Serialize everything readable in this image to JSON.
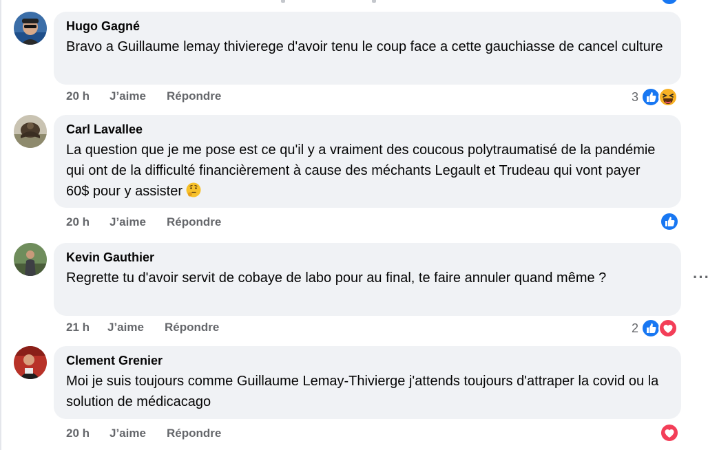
{
  "comments": [
    {
      "author": "Hugo Gagné",
      "text": "Bravo a Guillaume lemay thivierege d'avoir tenu le coup face a cette gauchiasse de cancel culture",
      "time": "20 h",
      "like_label": "J’aime",
      "reply_label": "Répondre",
      "reaction_count": "3",
      "reactions": [
        "like-icon",
        "laughing-emoji-icon"
      ]
    },
    {
      "author": "Carl Lavallee",
      "text": "La question que je me pose est ce qu'il y a vraiment des coucous polytraumatisé de la pandémie qui ont de la difficulté financièrement à cause des méchants Legault et Trudeau qui vont payer 60$ pour y assister",
      "inline_emoji": "thinking-face-emoji",
      "time": "20 h",
      "like_label": "J’aime",
      "reply_label": "Répondre",
      "reaction_count": "",
      "reactions": [
        "like-icon"
      ]
    },
    {
      "author": "Kevin Gauthier",
      "text": "Regrette tu d'avoir servit de cobaye de labo pour au final, te faire annuler quand même ?",
      "time": "21 h",
      "like_label": "J’aime",
      "reply_label": "Répondre",
      "reaction_count": "2",
      "reactions": [
        "like-icon",
        "love-heart-icon"
      ],
      "more_label": "···"
    },
    {
      "author": "Clement Grenier",
      "text": "Moi je suis toujours comme Guillaume Lemay-Thivierge j'attends toujours d'attraper la covid ou la solution de médicacago",
      "time": "20 h",
      "like_label": "J’aime",
      "reply_label": "Répondre",
      "reaction_count": "",
      "reactions": [
        "love-heart-icon"
      ]
    }
  ],
  "colors": {
    "bubble": "#f0f2f5",
    "meta_text": "#65676b",
    "like_blue": "#1877f2",
    "love_red": "#f33e58",
    "haha_yellow": "#f7b125"
  }
}
